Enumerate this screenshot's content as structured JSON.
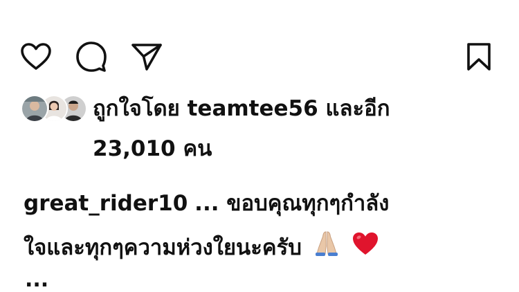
{
  "actions": {
    "like_icon": "heart-icon",
    "comment_icon": "speech-bubble-icon",
    "share_icon": "paper-plane-icon",
    "save_icon": "bookmark-icon"
  },
  "likes": {
    "prefix": "ถูกใจโดย",
    "user": "teamtee56",
    "connector": "และอีก",
    "count": "23,010",
    "unit": "คน"
  },
  "caption": {
    "username": "great_rider10",
    "text_line1": "... ขอบคุณทุกๆกำลัง",
    "text_line2": "ใจและทุกๆความห่วงใยนะครับ"
  },
  "more": "..."
}
